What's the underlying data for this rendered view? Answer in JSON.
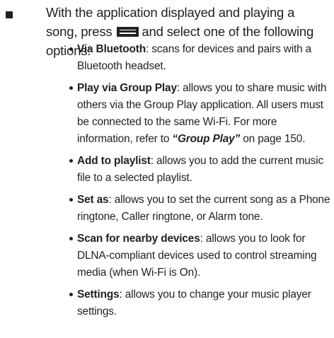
{
  "intro": {
    "text_before_icon": "With the application displayed and playing a song, press",
    "icon": "menu-key-icon",
    "text_after_icon": "and select one of the following options:"
  },
  "options": [
    {
      "term": "Via Bluetooth",
      "description": ": scans for devices and pairs with a Bluetooth headset."
    },
    {
      "term": "Play via Group Play",
      "description_before_ref": ": allows you to share music with others via the Group Play application. All users must be connected to the same Wi-Fi. For more information, refer to ",
      "ref": "“Group Play”",
      "description_after_ref": " on page 150."
    },
    {
      "term": "Add to playlist",
      "description": ": allows you to add the current music file to a selected playlist."
    },
    {
      "term": "Set as",
      "description": ": allows you to set the current song as a Phone ringtone, Caller ringtone, or Alarm tone."
    },
    {
      "term": "Scan for nearby devices",
      "description": ": allows you to look for DLNA-compliant devices used to control streaming media (when Wi-Fi is On)."
    },
    {
      "term": "Settings",
      "description": ": allows you to change your music player settings."
    }
  ]
}
